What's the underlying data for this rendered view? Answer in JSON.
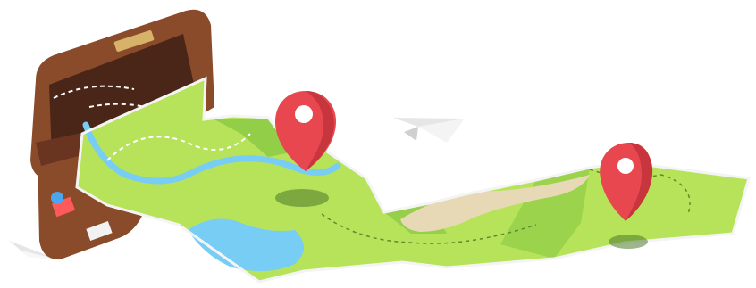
{
  "scene": {
    "colors": {
      "background": "#ffffff",
      "suitcase_brown": "#8a4b2a",
      "suitcase_dark": "#4a2618",
      "map_green": "#b7e35a",
      "map_dark_green": "#7cbf3c",
      "water_blue": "#77cdf3",
      "sand": "#e8d9b6",
      "pin_red": "#e9474f",
      "paper_white": "#f4f4f4"
    },
    "icons": [
      "suitcase-icon",
      "map-icon",
      "location-pin-icon",
      "paper-plane-icon"
    ]
  }
}
